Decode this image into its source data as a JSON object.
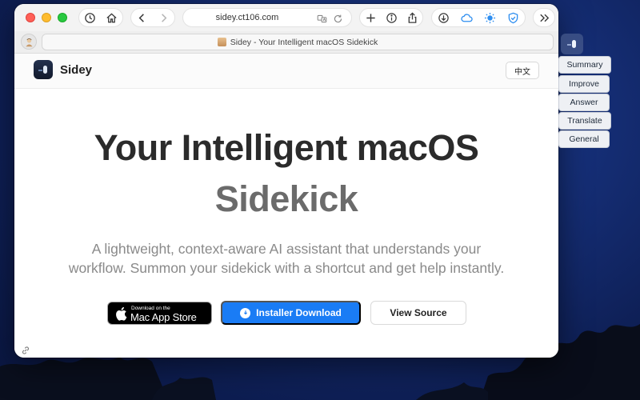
{
  "browser": {
    "url": "sidey.ct106.com",
    "tab_title": "Sidey - Your Intelligent macOS Sidekick",
    "toolbar_icons": [
      "history-icon",
      "home-icon",
      "back-icon",
      "forward-icon",
      "translate-icon",
      "reload-icon",
      "new-tab-icon",
      "info-icon",
      "share-icon",
      "downloads-icon",
      "cloud-icon",
      "brightness-icon",
      "shield-icon",
      "more-icon"
    ]
  },
  "site": {
    "brand": "Sidey",
    "language_button": "中文",
    "hero_title_line1": "Your Intelligent macOS",
    "hero_title_line2": "Sidekick",
    "hero_subtitle_line1": "A lightweight, context-aware AI assistant that understands your",
    "hero_subtitle_line2": "workflow. Summon your sidekick with a shortcut and get help instantly.",
    "appstore_small": "Download on the",
    "appstore_big": "Mac App Store",
    "primary_button": "Installer Download",
    "secondary_button": "View Source"
  },
  "sidey_panel": {
    "items": [
      "Summary",
      "Improve",
      "Answer",
      "Translate",
      "General"
    ]
  },
  "colors": {
    "primary": "#1a7cf5",
    "hero_dark": "#2b2b2b",
    "hero_muted": "#6b6b6b",
    "subtitle": "#8a8a8a"
  }
}
